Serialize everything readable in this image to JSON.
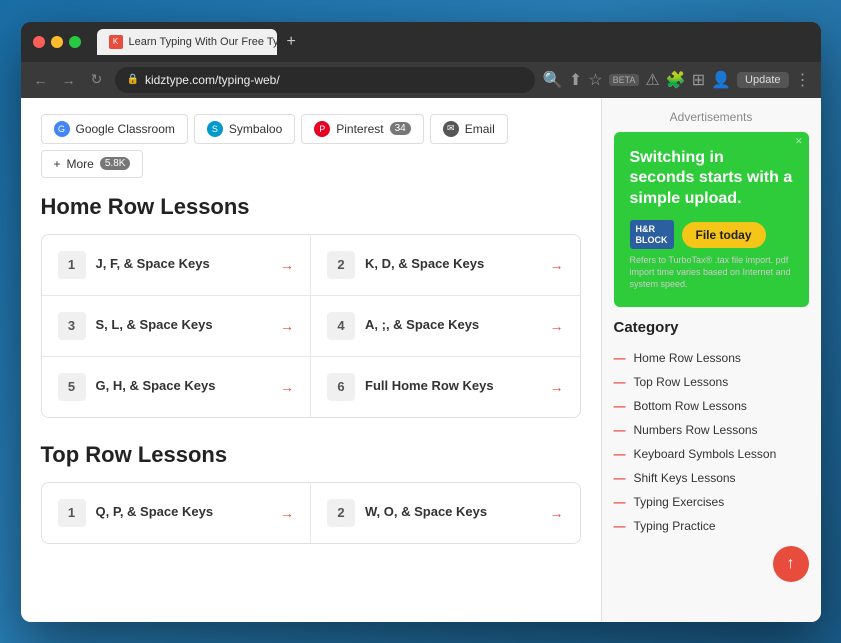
{
  "browser": {
    "tab_title": "Learn Typing With Our Free Ty...",
    "url": "kidztype.com/typing-web/",
    "new_tab_label": "+",
    "update_label": "Update",
    "beta_label": "BETA"
  },
  "share_buttons": [
    {
      "id": "google-classroom",
      "icon_type": "google",
      "label": "Google Classroom"
    },
    {
      "id": "symbaloo",
      "icon_type": "symbaloo",
      "label": "Symbaloo"
    },
    {
      "id": "pinterest",
      "icon_type": "pinterest",
      "label": "Pinterest",
      "count": "34"
    },
    {
      "id": "email",
      "icon_type": "email",
      "label": "Email"
    }
  ],
  "more_button": {
    "label": "More",
    "count": "5.8K"
  },
  "home_row": {
    "section_title": "Home Row Lessons",
    "lessons": [
      {
        "number": "1",
        "title": "J, F, & Space Keys"
      },
      {
        "number": "2",
        "title": "K, D, & Space Keys"
      },
      {
        "number": "3",
        "title": "S, L, & Space Keys"
      },
      {
        "number": "4",
        "title": "A, ;, & Space Keys"
      },
      {
        "number": "5",
        "title": "G, H, & Space Keys"
      },
      {
        "number": "6",
        "title": "Full Home Row Keys"
      }
    ]
  },
  "top_row": {
    "section_title": "Top Row Lessons",
    "lessons": [
      {
        "number": "1",
        "title": "Q, P, & Space Keys"
      },
      {
        "number": "2",
        "title": "W, O, & Space Keys"
      }
    ]
  },
  "sidebar": {
    "ads_title": "Advertisements",
    "ad": {
      "headline": "Switching in seconds starts with a simple upload.",
      "hr_block_line1": "H&R",
      "hr_block_line2": "BLOCK",
      "file_today": "File today",
      "fine_print": "Refers to TurboTax® .tax file import. pdf import time varies based on Internet and system speed."
    },
    "category_title": "Category",
    "categories": [
      "Home Row Lessons",
      "Top Row Lessons",
      "Bottom Row Lessons",
      "Numbers Row Lessons",
      "Keyboard Symbols Lesson",
      "Shift Keys Lessons",
      "Typing Exercises",
      "Typing Practice"
    ]
  }
}
